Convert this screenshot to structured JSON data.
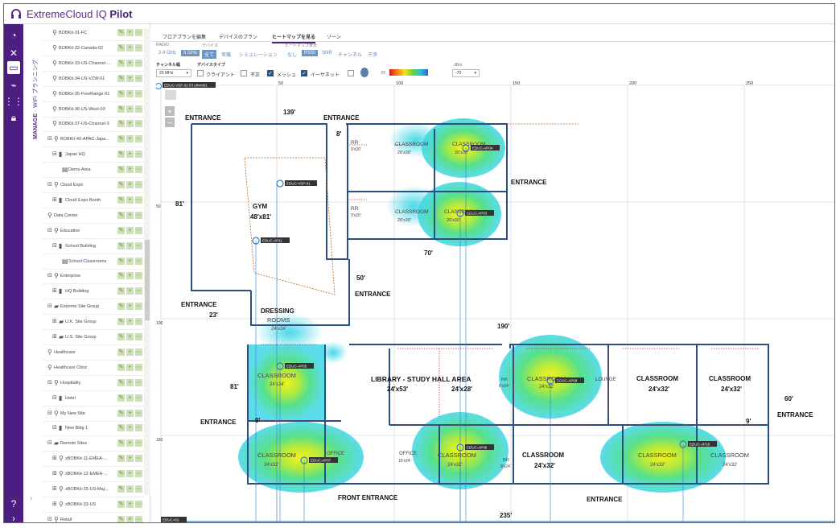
{
  "app": {
    "title_prefix": "ExtremeCloud IQ",
    "title_bold": "Pilot"
  },
  "rail": {
    "vertical_label_bold": "MANAGE",
    "vertical_label": " · WiFi プランニング"
  },
  "sidebar": {
    "items": [
      {
        "label": "BOBKit-31-FC",
        "indent": 1,
        "icon": "pin-icon"
      },
      {
        "label": "BOBKit-32-Canada-02",
        "indent": 1,
        "icon": "pin-icon"
      },
      {
        "label": "BOBKit-33-US-Channel-...",
        "indent": 1,
        "icon": "pin-icon"
      },
      {
        "label": "BOBKit-34-US-VZW-01",
        "indent": 1,
        "icon": "pin-icon"
      },
      {
        "label": "BOBKit-35-FreeRange-01",
        "indent": 1,
        "icon": "pin-icon"
      },
      {
        "label": "BOBKit-36-US-West-03",
        "indent": 1,
        "icon": "pin-icon"
      },
      {
        "label": "BOBKit-37-US-Channel-3",
        "indent": 1,
        "icon": "pin-icon"
      },
      {
        "label": "BOBKit-40-APAC-Japa...",
        "indent": 0,
        "icon": "pin-icon",
        "expander": "⊟"
      },
      {
        "label": "Japan HQ",
        "indent": 1,
        "icon": "building-icon",
        "expander": "⊟"
      },
      {
        "label": "Demo Area",
        "indent": 3,
        "icon": "floor-icon"
      },
      {
        "label": "Cloud Expo",
        "indent": 0,
        "icon": "pin-icon",
        "expander": "⊟"
      },
      {
        "label": "Cloud Expo Booth",
        "indent": 1,
        "icon": "building-icon",
        "expander": "⊞"
      },
      {
        "label": "Data Center",
        "indent": 0,
        "icon": "pin-icon"
      },
      {
        "label": "Education",
        "indent": 0,
        "icon": "pin-icon",
        "expander": "⊟"
      },
      {
        "label": "School Building",
        "indent": 1,
        "icon": "building-icon",
        "expander": "⊟"
      },
      {
        "label": "School Classrooms",
        "indent": 3,
        "icon": "floor-icon",
        "selected": true
      },
      {
        "label": "Enterprise",
        "indent": 0,
        "icon": "pin-icon",
        "expander": "⊟"
      },
      {
        "label": "HQ Building",
        "indent": 1,
        "icon": "building-icon",
        "expander": "⊞"
      },
      {
        "label": "Extreme Site Group",
        "indent": 0,
        "icon": "folder-icon",
        "expander": "⊟"
      },
      {
        "label": "U.K. Site Group",
        "indent": 1,
        "icon": "folder-icon",
        "expander": "⊞"
      },
      {
        "label": "U.S. Site Group",
        "indent": 1,
        "icon": "folder-icon",
        "expander": "⊞"
      },
      {
        "label": "Healthcare",
        "indent": 0,
        "icon": "pin-icon"
      },
      {
        "label": "Healthcare Clinic",
        "indent": 0,
        "icon": "pin-icon"
      },
      {
        "label": "Hospitality",
        "indent": 0,
        "icon": "pin-icon",
        "expander": "⊟"
      },
      {
        "label": "Hotel",
        "indent": 1,
        "icon": "building-icon",
        "expander": "⊟"
      },
      {
        "label": "My New Site",
        "indent": 0,
        "icon": "pin-icon",
        "expander": "⊟"
      },
      {
        "label": "New Bldg 1",
        "indent": 1,
        "icon": "building-icon",
        "expander": "⊟"
      },
      {
        "label": "Remote Sites",
        "indent": 0,
        "icon": "folder-icon",
        "expander": "⊟"
      },
      {
        "label": "xBOBKit-11-EMEA-...",
        "indent": 1,
        "icon": "pin-icon",
        "expander": "⊞"
      },
      {
        "label": "xBOBKit-12-EMEA-...",
        "indent": 1,
        "icon": "pin-icon",
        "expander": "⊞"
      },
      {
        "label": "xBOBKit-25-US-Maj...",
        "indent": 1,
        "icon": "pin-icon",
        "expander": "⊞"
      },
      {
        "label": "xBOBKit-33-US",
        "indent": 1,
        "icon": "pin-icon",
        "expander": "⊞"
      },
      {
        "label": "Retail",
        "indent": 0,
        "icon": "pin-icon",
        "expander": "⊟"
      }
    ]
  },
  "tabs": [
    "フロアプランを編集",
    "デバイスのプラン",
    "ヒートマップを見る",
    "ゾーン"
  ],
  "active_tab": 2,
  "toolbar": {
    "radio_label": "RADIO",
    "radio_options": [
      "2.4 GHz",
      "5 GHz"
    ],
    "radio_selected": "5 GHz",
    "device_label": "デバイス",
    "device_options": [
      "全て",
      "実機",
      "シミュレーション"
    ],
    "device_selected": "全て",
    "heatmap_label": "ヒートマップ表示",
    "heatmap_options": [
      "なし",
      "RSSI",
      "SNR",
      "チャンネル",
      "干渉"
    ],
    "heatmap_selected": "RSSI",
    "channel_width_label": "チャンネル幅",
    "channel_width_value": "20 MHz",
    "device_type_label": "デバイスタイプ",
    "client_label": "クライアント",
    "rogue_label": "不正",
    "mesh_label": "メッシュ",
    "ethernet_label": "イーサネット",
    "scale_min": "-35",
    "dbm_label": "dBm",
    "dbm_value": "-70"
  },
  "map": {
    "ruler_top": [
      "50",
      "100",
      "150",
      "200",
      "250"
    ],
    "ruler_left": [
      "50",
      "100",
      "150"
    ],
    "zoom_in": "+",
    "zoom_out": "−",
    "ap_label_top": "EDUC-VSP-02 ‖ ‖ ethrnt01",
    "aps": [
      "EDUC-AP04",
      "EDUC-VSP-01",
      "EDUC-AP03",
      "EDUC-AP11",
      "EDUC-AP05",
      "EDUC-AP09",
      "EDUC-AP07",
      "EDUC-AP06",
      "EDUC-AP10"
    ],
    "dims": [
      "139'",
      "8'",
      "81'",
      "70'",
      "50'",
      "23'",
      "190'",
      "81'",
      "9'",
      "60'",
      "9'",
      "235'"
    ],
    "entrances": [
      "ENTRANCE",
      "ENTRANCE",
      "ENTRANCE",
      "ENTRANCE",
      "ENTRANCE",
      "ENTRANCE",
      "ENTRANCE",
      "ENTRANCE",
      "FRONT ENTRANCE"
    ],
    "gym": "GYM",
    "gym_size": "48'x81'",
    "rr": "RR",
    "rr_size": "9'x20'",
    "classroom": "CLASSROOM",
    "classroom_sm": "20'x30'",
    "classroom_lg": "24'x32'",
    "classroom_sq": "24'x24'",
    "dressing": "DRESSING",
    "rooms": "ROOMS",
    "library": "LIBRARY - STUDY HALL AREA",
    "library_size": "24'x53'",
    "library_size2": "24'x28'",
    "lounge": "LOUNGE",
    "office": "OFFICE",
    "office_size": "16'x24'",
    "rr_small": "RR",
    "rr_small_size": "8'x24'",
    "status_tag": "EDUC-NS"
  }
}
